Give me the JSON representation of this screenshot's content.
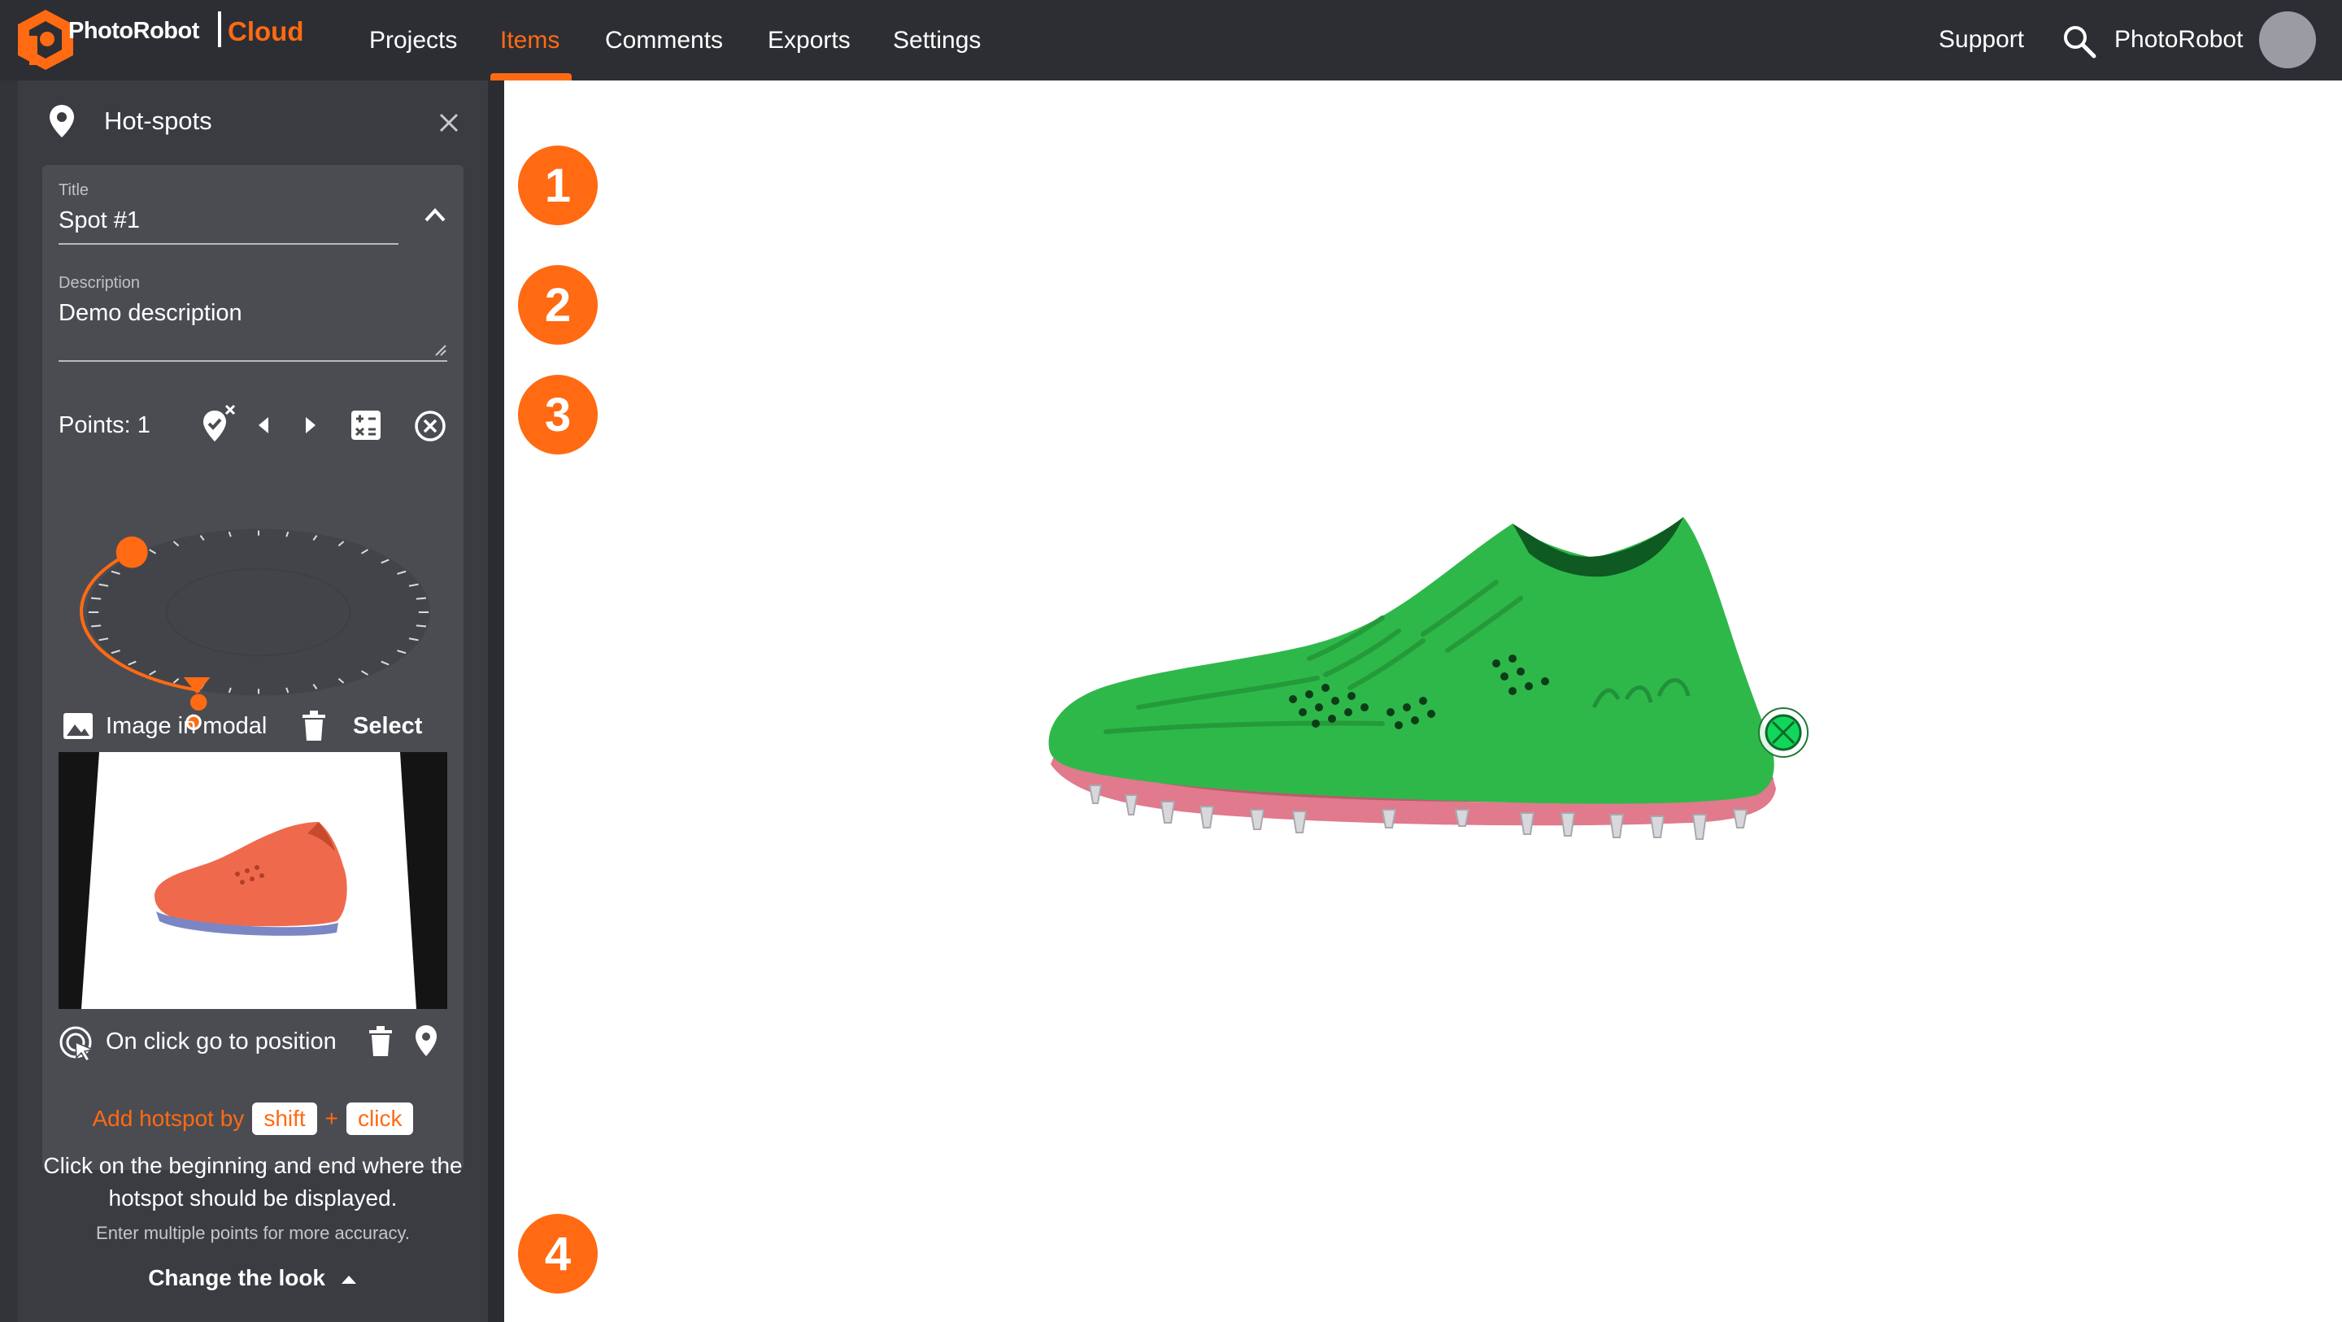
{
  "app": {
    "brand": "PhotoRobot",
    "product": "Cloud"
  },
  "nav": {
    "items": [
      {
        "label": "Projects",
        "active": false
      },
      {
        "label": "Items",
        "active": true
      },
      {
        "label": "Comments",
        "active": false
      },
      {
        "label": "Exports",
        "active": false
      },
      {
        "label": "Settings",
        "active": false
      }
    ],
    "support": "Support",
    "user": "PhotoRobot"
  },
  "panel": {
    "title": "Hot-spots",
    "title_field": {
      "label": "Title",
      "value": "Spot #1"
    },
    "description_field": {
      "label": "Description",
      "value": "Demo description"
    },
    "points_label": "Points: 1",
    "image_label": "Image in modal",
    "select_label": "Select",
    "goto_label": "On click go to position",
    "hint": {
      "prefix": "Add hotspot by",
      "key1": "shift",
      "plus": "+",
      "key2": "click",
      "body": "Click on the beginning and end where the hotspot should be displayed.",
      "small": "Enter multiple points for more accuracy.",
      "change_look": "Change the look"
    }
  },
  "viewer": {
    "badges": [
      "1",
      "2",
      "3",
      "4"
    ]
  },
  "colors": {
    "accent": "#ff6a13",
    "topbar": "#2c2e33",
    "panel": "#3a3c42",
    "card": "#4a4c52",
    "shoe_viewer": "#2fb84a",
    "shoe_thumb": "#ef6a4c"
  },
  "icons": [
    "logo-icon",
    "search-icon",
    "pin-icon",
    "close-icon",
    "chevron-up-icon",
    "add-point-icon",
    "prev-icon",
    "next-icon",
    "calculator-icon",
    "clear-icon",
    "image-icon",
    "trash-icon",
    "cursor-target-icon",
    "caret-up-icon"
  ]
}
